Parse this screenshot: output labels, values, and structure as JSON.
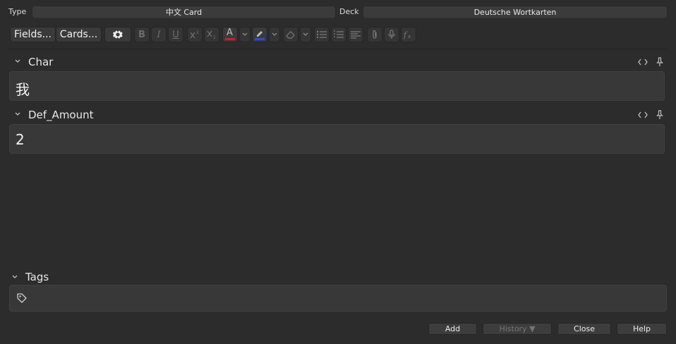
{
  "header": {
    "type_label": "Type",
    "type_value": "中文 Card",
    "deck_label": "Deck",
    "deck_value": "Deutsche Wortkarten"
  },
  "toolbar": {
    "fields_label": "Fields...",
    "cards_label": "Cards...",
    "bold": "B",
    "italic": "I",
    "underline": "U",
    "font_color_icon": "A"
  },
  "fields": [
    {
      "name": "Char",
      "value": "我"
    },
    {
      "name": "Def_Amount",
      "value": "2"
    }
  ],
  "tags": {
    "label": "Tags"
  },
  "buttons": {
    "add": "Add",
    "history": "History ▼",
    "close": "Close",
    "help": "Help"
  },
  "colors": {
    "background": "#2c2c2c",
    "font_color_bar": "#d02020",
    "highlight_bar": "#2050e0"
  }
}
